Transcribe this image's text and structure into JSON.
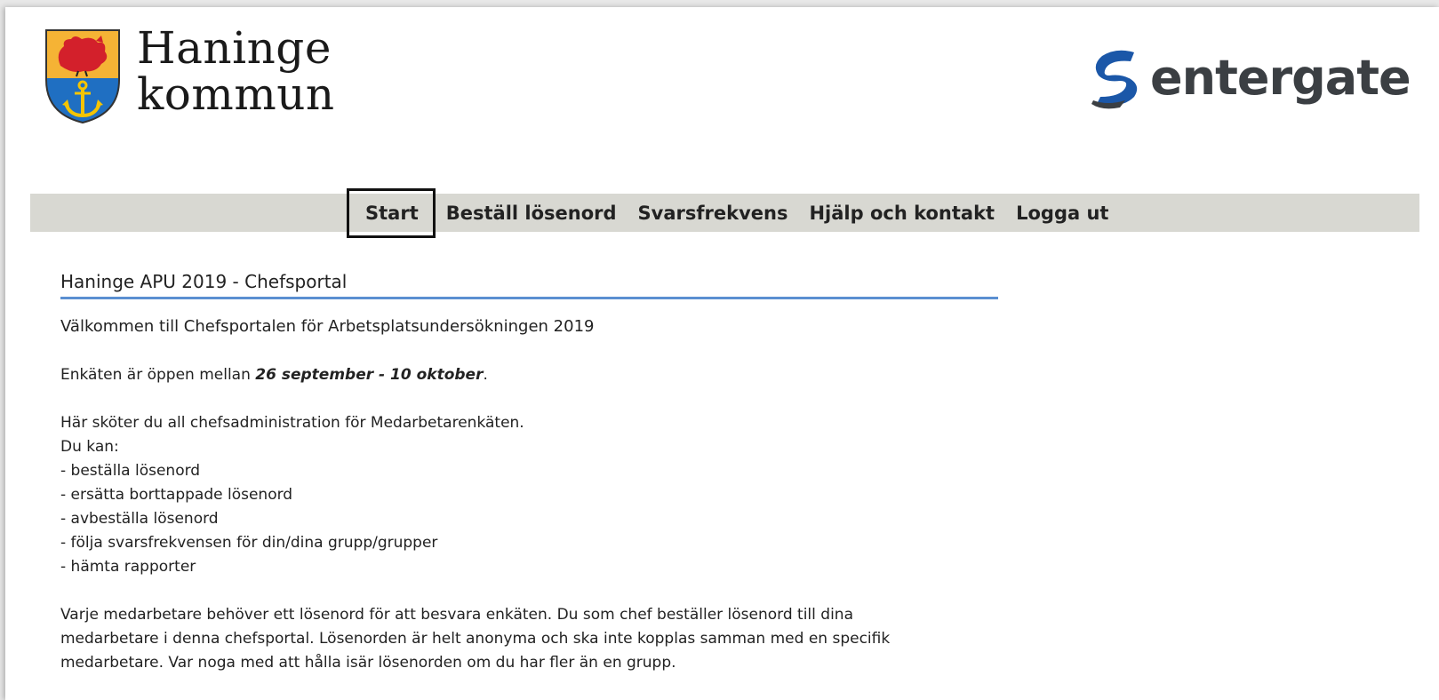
{
  "header": {
    "brand_line1": "Haninge",
    "brand_line2": "kommun",
    "partner_name": "entergate",
    "crest_icon": "haninge-crest-icon",
    "partner_icon": "entergate-swirl-icon",
    "colors": {
      "crest_top": "#f5b335",
      "crest_bottom": "#1f6fc2",
      "bird": "#d3202b",
      "anchor": "#f5c400",
      "partner_swirl": "#1b57a8",
      "partner_text": "#3b3f43"
    }
  },
  "nav": {
    "items": [
      {
        "label": "Start",
        "active": true
      },
      {
        "label": "Beställ lösenord",
        "active": false
      },
      {
        "label": "Svarsfrekvens",
        "active": false
      },
      {
        "label": "Hjälp och kontakt",
        "active": false
      },
      {
        "label": "Logga ut",
        "active": false
      }
    ],
    "background": "#d8d8d2"
  },
  "main": {
    "title": "Haninge APU 2019 - Chefsportal",
    "title_underline_color": "#5b8fd1",
    "welcome": "Välkommen till Chefsportalen för Arbetsplatsundersökningen 2019",
    "open_prefix": "Enkäten är öppen mellan ",
    "open_dates": "26 september - 10 oktober",
    "open_suffix": ".",
    "intro_lines": [
      "Här sköter du all chefsadministration för Medarbetarenkäten.",
      "Du kan:",
      "- beställa lösenord",
      "- ersätta borttappade lösenord",
      "- avbeställa lösenord",
      "- följa svarsfrekvensen för din/dina grupp/grupper",
      "- hämta rapporter"
    ],
    "password_lines": [
      "Varje medarbetare behöver ett lösenord för att besvara enkäten. Du som chef beställer lösenord till dina",
      "medarbetare i denna chefsportal. Lösenorden är helt anonyma och ska inte kopplas samman med en specifik",
      "medarbetare. Var noga med att hålla isär lösenorden om du har fler än en grupp."
    ]
  }
}
